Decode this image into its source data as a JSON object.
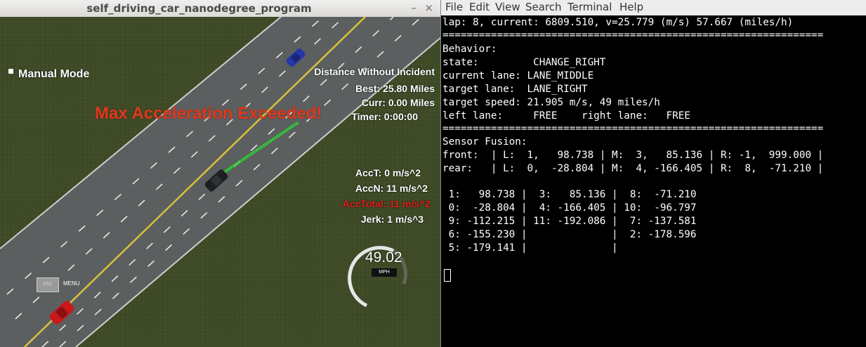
{
  "simulator": {
    "window_title": "self_driving_car_nanodegree_program",
    "minimize_glyph": "–",
    "close_glyph": "×",
    "manual_mode_label": "Manual Mode",
    "distance_title": "Distance Without Incident",
    "best": "Best: 25.80 Miles",
    "curr": "Curr: 0.00 Miles",
    "timer": "Timer: 0:00:00",
    "warning": "Max Acceleration Exceeded!",
    "acc_t": "AccT: 0 m/s^2",
    "acc_n": "AccN: 11 m/s^2",
    "acc_total": "AccTotal: 11 m/s^2",
    "jerk": "Jerk: 1 m/s^3",
    "speed_value": "49.02",
    "speed_unit": "MPH",
    "esc_label": "ESC",
    "menu_label": "MENU",
    "colors": {
      "grass": "#3d4a26",
      "road": "#5a5d5e",
      "lane_yellow": "#d8c23a",
      "warning_red": "#e03a1d",
      "path_green": "#27d82c"
    }
  },
  "terminal": {
    "menu": [
      "File",
      "Edit",
      "View",
      "Search",
      "Terminal",
      "Help"
    ],
    "lines": [
      "lap: 8, current: 6809.510, v=25.779 (m/s) 57.667 (miles/h)",
      "===============================================================",
      "Behavior:",
      "state:         CHANGE_RIGHT",
      "current lane: LANE_MIDDLE",
      "target lane:  LANE_RIGHT",
      "target speed: 21.905 m/s, 49 miles/h",
      "left lane:     FREE    right lane:   FREE",
      "===============================================================",
      "Sensor Fusion:",
      "front:  | L:  1,   98.738 | M:  3,   85.136 | R: -1,  999.000 |",
      "rear:   | L:  0,  -28.804 | M:  4, -166.405 | R:  8,  -71.210 |",
      "",
      " 1:   98.738 |  3:   85.136 |  8:  -71.210",
      " 0:  -28.804 |  4: -166.405 | 10:  -96.797",
      " 9: -112.215 | 11: -192.086 |  7: -137.581",
      " 6: -155.230 |              |  2: -178.596",
      " 5: -179.141 |              |"
    ]
  }
}
